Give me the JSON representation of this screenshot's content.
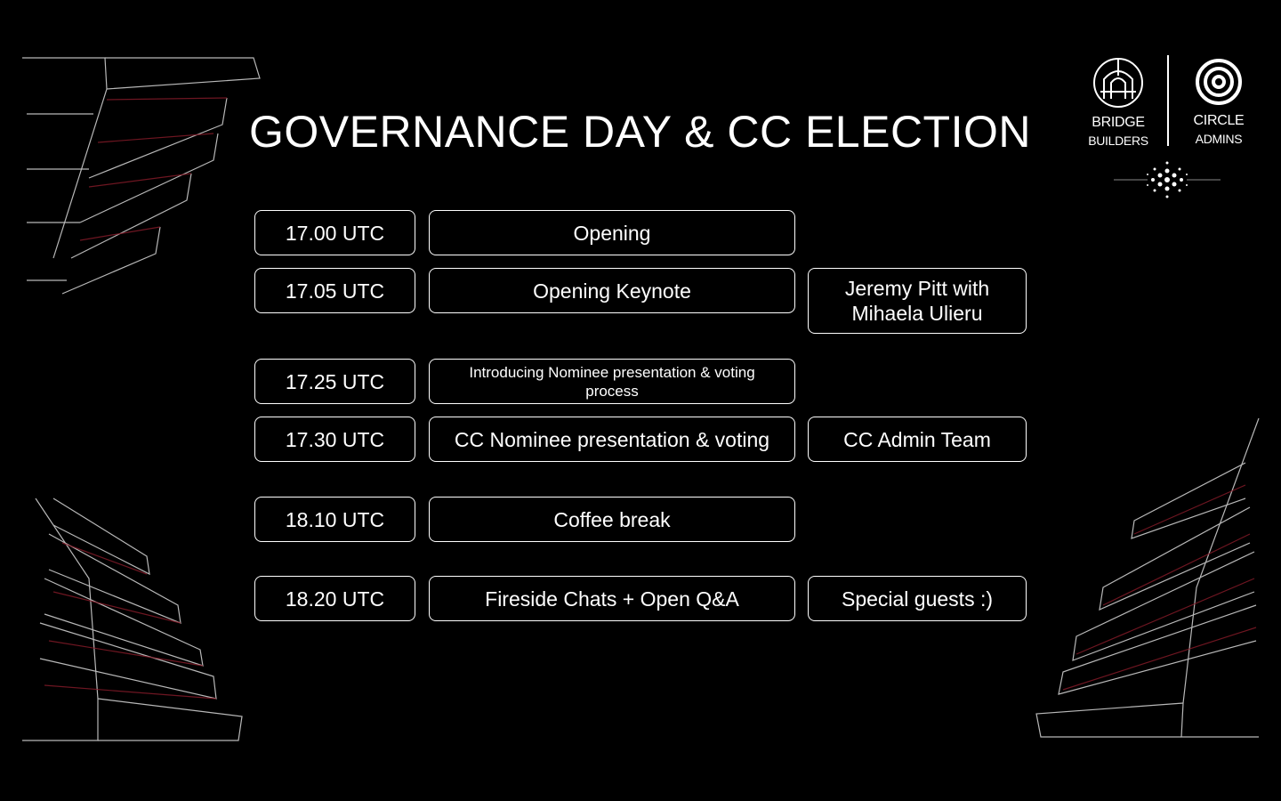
{
  "title": "GOVERNANCE DAY & CC ELECTION",
  "logos": {
    "bridge_builders": [
      "BRIDGE",
      "BUILDERS"
    ],
    "circle_admins": [
      "CIRCLE",
      "ADMINS"
    ]
  },
  "schedule": [
    {
      "time": "17.00 UTC",
      "session": "Opening",
      "speaker": ""
    },
    {
      "time": "17.05 UTC",
      "session": "Opening Keynote",
      "speaker": "Jeremy Pitt with Mihaela Ulieru"
    },
    {
      "time": "17.25 UTC",
      "session": "Introducing Nominee presentation & voting process",
      "speaker": ""
    },
    {
      "time": "17.30 UTC",
      "session": "CC Nominee presentation & voting",
      "speaker": "CC Admin Team"
    },
    {
      "time": "18.10 UTC",
      "session": "Coffee break",
      "speaker": ""
    },
    {
      "time": "18.20 UTC",
      "session": "Fireside Chats + Open Q&A",
      "speaker": "Special guests :)"
    }
  ],
  "colors": {
    "background": "#000000",
    "foreground": "#ffffff",
    "accent_lines": "#8a1c2a"
  }
}
